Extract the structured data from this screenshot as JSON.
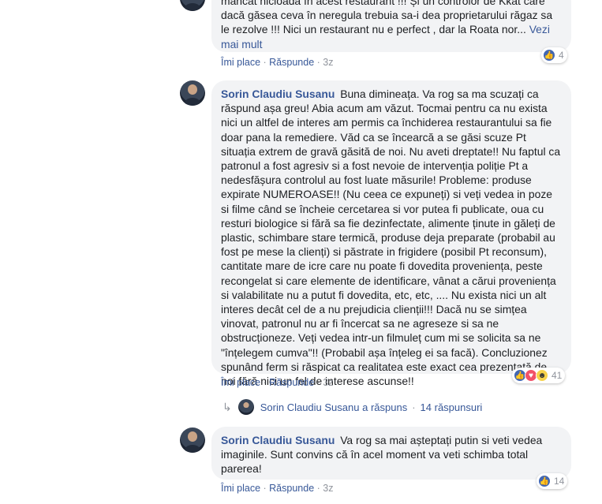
{
  "comment_top": {
    "text": "mâncat nicioadă în acest restaurant !!! Și un controlor de Kkat care dacă găsea ceva în neregula trebuia sa-i dea proprietarului răgaz sa le rezolve !!! Nici un restaurant nu e perfect , dar la Roata nor...",
    "see_more": "Vezi mai mult",
    "like_label": "Îmi place",
    "reply_label": "Răspunde",
    "time": "3z",
    "reaction_count": "4"
  },
  "comment_main": {
    "author": "Sorin Claudiu Susanu",
    "text": "Buna dimineața. Va rog sa ma scuzați ca răspund așa greu! Abia acum am văzut. Tocmai pentru ca nu exista nici un altfel de interes am permis ca închiderea restaurantului sa fie doar pana la remediere. Văd ca se încearcă a se găsi scuze Pt situația extrem de gravă găsită de noi. Nu aveti dreptate!! Nu faptul ca patronul a fost agresiv si a fost nevoie de intervenția poliție Pt a nedesfășura controlul au fost luate măsurile! Probleme: produse expirate NUMEROASE!! (Nu ceea ce expuneți) si veți vedea in poze si filme când se încheie cercetarea si vor putea fi publicate, oua cu resturi biologice si fără sa fie dezinfectate, alimente ținute in găleți de plastic, schimbare stare termică, produse deja preparate (probabil au fost pe mese la clienți) si păstrate in frigidere (posibil Pt reconsum), cantitate mare de icre care nu poate fi dovedita proveniența, peste recongelat si care elemente de identificare, vânat a cărui proveniența si valabilitate nu a putut fi dovedita, etc, etc, .... Nu exista nici un alt interes decât cel de a nu prejudicia clienții!!! Dacă nu se simțea vinovat, patronul nu ar fi încercat sa ne agreseze si sa ne obstrucționeze. Veți vedea intr-un filmuleț cum mi se solicita sa ne \"înțelegem cumva\"!! (Probabil așa înțeleg ei sa facă). Concluzionez spunând ferm si răspicat ca realitatea este exact cea prezentată de noi fără nici un fel de interese ascunse!!",
    "like_label": "Îmi place",
    "reply_label": "Răspunde",
    "time": "3z",
    "reaction_count": "41"
  },
  "replies_summary": {
    "author": "Sorin Claudiu Susanu",
    "action": "a răspuns",
    "separator": "·",
    "count_label": "14 răspunsuri"
  },
  "comment_bottom": {
    "author": "Sorin Claudiu Susanu",
    "text": "Va rog sa mai așteptați putin si veti vedea imaginile. Sunt convins că în acel moment va veti schimba total parerea!",
    "like_label": "Îmi place",
    "reply_label": "Răspunde",
    "time": "3z",
    "reaction_count": "14"
  },
  "separator": "·",
  "colors": {
    "link": "#385898",
    "bubble": "#f2f3f5",
    "meta": "#90949c",
    "like": "#4267b2",
    "love": "#f25268",
    "haha": "#f7d24b"
  },
  "icons": {
    "like": "thumbs-up-icon",
    "love": "heart-icon",
    "haha": "laughing-face-icon",
    "reply_arrow": "reply-arrow-icon"
  }
}
